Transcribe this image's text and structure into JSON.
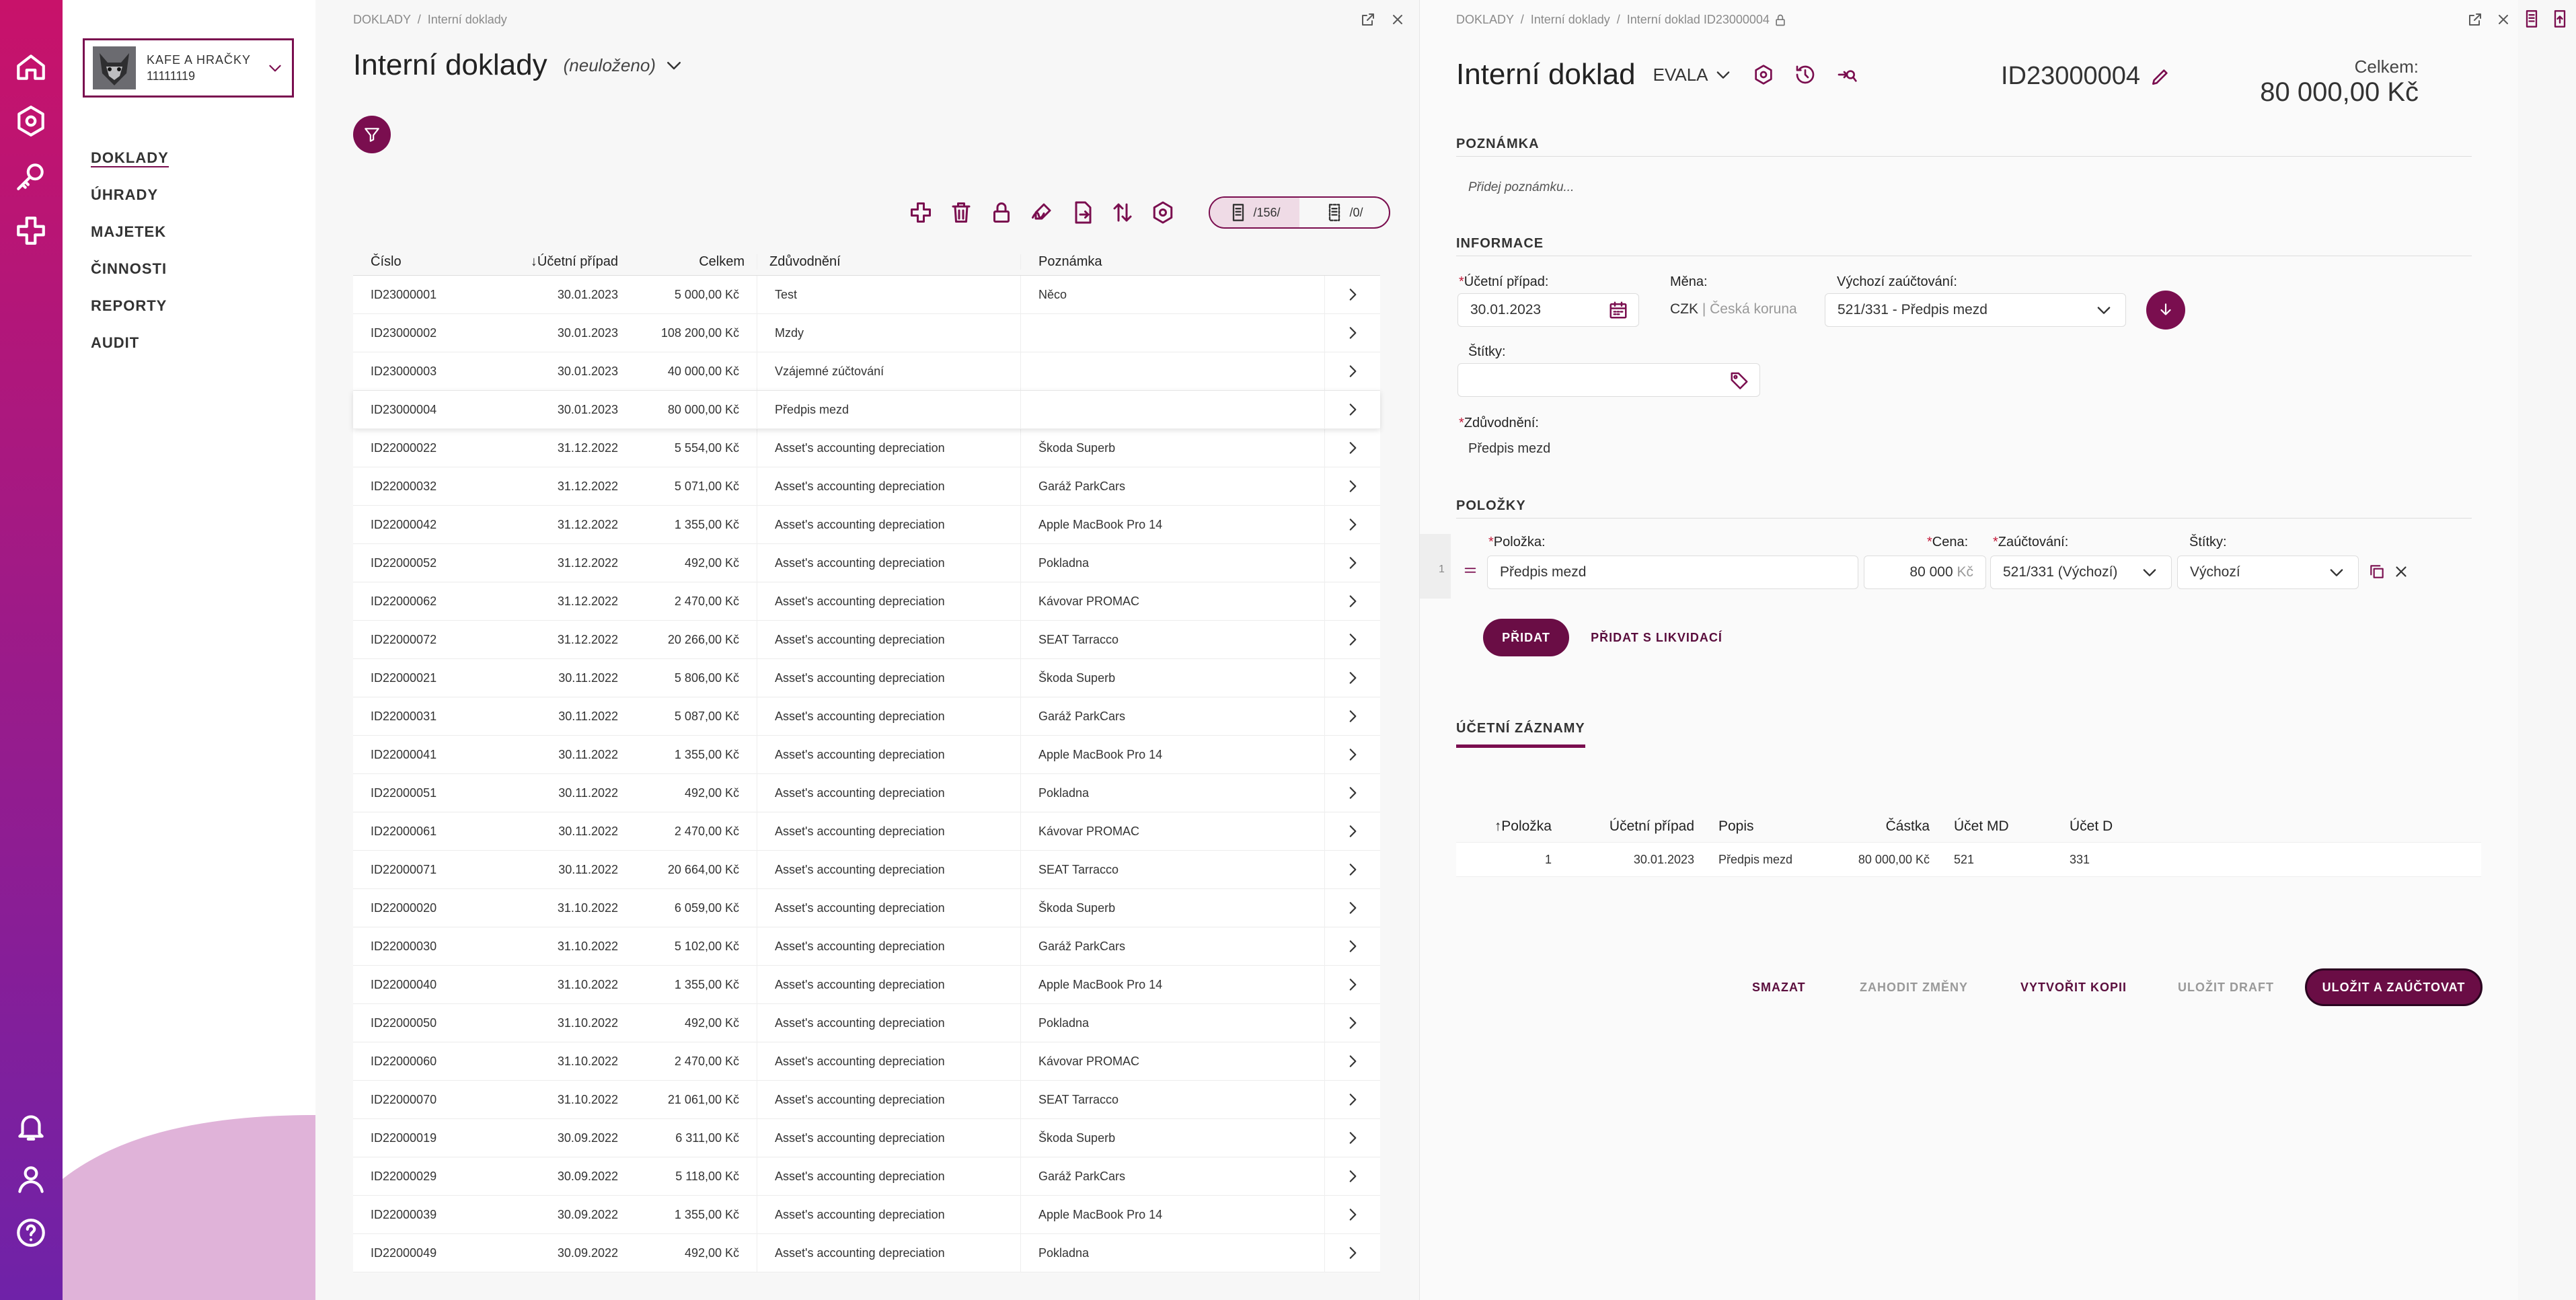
{
  "company": {
    "name": "KAFE A HRAČKY",
    "id": "11111119"
  },
  "nav": [
    "DOKLADY",
    "ÚHRADY",
    "MAJETEK",
    "ČINNOSTI",
    "REPORTY",
    "AUDIT"
  ],
  "list": {
    "breadcrumb": "DOKLADY  /  Interní doklady",
    "title": "Interní doklady",
    "status": "(neuloženo)",
    "toggle": {
      "left": "/156/",
      "right": "/0/"
    },
    "columns": [
      "Číslo",
      "Účetní případ",
      "Celkem",
      "Zdůvodnění",
      "Poznámka"
    ],
    "rows": [
      [
        "ID23000001",
        "30.01.2023",
        "5 000,00 Kč",
        "Test",
        "Něco"
      ],
      [
        "ID23000002",
        "30.01.2023",
        "108 200,00 Kč",
        "Mzdy",
        ""
      ],
      [
        "ID23000003",
        "30.01.2023",
        "40 000,00 Kč",
        "Vzájemné zúčtování",
        ""
      ],
      [
        "ID23000004",
        "30.01.2023",
        "80 000,00 Kč",
        "Předpis mezd",
        ""
      ],
      [
        "ID22000022",
        "31.12.2022",
        "5 554,00 Kč",
        "Asset's accounting depreciation",
        "Škoda Superb"
      ],
      [
        "ID22000032",
        "31.12.2022",
        "5 071,00 Kč",
        "Asset's accounting depreciation",
        "Garáž ParkCars"
      ],
      [
        "ID22000042",
        "31.12.2022",
        "1 355,00 Kč",
        "Asset's accounting depreciation",
        "Apple MacBook Pro 14"
      ],
      [
        "ID22000052",
        "31.12.2022",
        "492,00 Kč",
        "Asset's accounting depreciation",
        "Pokladna"
      ],
      [
        "ID22000062",
        "31.12.2022",
        "2 470,00 Kč",
        "Asset's accounting depreciation",
        "Kávovar PROMAC"
      ],
      [
        "ID22000072",
        "31.12.2022",
        "20 266,00 Kč",
        "Asset's accounting depreciation",
        "SEAT Tarracco"
      ],
      [
        "ID22000021",
        "30.11.2022",
        "5 806,00 Kč",
        "Asset's accounting depreciation",
        "Škoda Superb"
      ],
      [
        "ID22000031",
        "30.11.2022",
        "5 087,00 Kč",
        "Asset's accounting depreciation",
        "Garáž ParkCars"
      ],
      [
        "ID22000041",
        "30.11.2022",
        "1 355,00 Kč",
        "Asset's accounting depreciation",
        "Apple MacBook Pro 14"
      ],
      [
        "ID22000051",
        "30.11.2022",
        "492,00 Kč",
        "Asset's accounting depreciation",
        "Pokladna"
      ],
      [
        "ID22000061",
        "30.11.2022",
        "2 470,00 Kč",
        "Asset's accounting depreciation",
        "Kávovar PROMAC"
      ],
      [
        "ID22000071",
        "30.11.2022",
        "20 664,00 Kč",
        "Asset's accounting depreciation",
        "SEAT Tarracco"
      ],
      [
        "ID22000020",
        "31.10.2022",
        "6 059,00 Kč",
        "Asset's accounting depreciation",
        "Škoda Superb"
      ],
      [
        "ID22000030",
        "31.10.2022",
        "5 102,00 Kč",
        "Asset's accounting depreciation",
        "Garáž ParkCars"
      ],
      [
        "ID22000040",
        "31.10.2022",
        "1 355,00 Kč",
        "Asset's accounting depreciation",
        "Apple MacBook Pro 14"
      ],
      [
        "ID22000050",
        "31.10.2022",
        "492,00 Kč",
        "Asset's accounting depreciation",
        "Pokladna"
      ],
      [
        "ID22000060",
        "31.10.2022",
        "2 470,00 Kč",
        "Asset's accounting depreciation",
        "Kávovar PROMAC"
      ],
      [
        "ID22000070",
        "31.10.2022",
        "21 061,00 Kč",
        "Asset's accounting depreciation",
        "SEAT Tarracco"
      ],
      [
        "ID22000019",
        "30.09.2022",
        "6 311,00 Kč",
        "Asset's accounting depreciation",
        "Škoda Superb"
      ],
      [
        "ID22000029",
        "30.09.2022",
        "5 118,00 Kč",
        "Asset's accounting depreciation",
        "Garáž ParkCars"
      ],
      [
        "ID22000039",
        "30.09.2022",
        "1 355,00 Kč",
        "Asset's accounting depreciation",
        "Apple MacBook Pro 14"
      ],
      [
        "ID22000049",
        "30.09.2022",
        "492,00 Kč",
        "Asset's accounting depreciation",
        "Pokladna"
      ]
    ]
  },
  "detail": {
    "breadcrumb": "DOKLADY  /  Interní doklady  /  Interní doklad ID23000004",
    "title": "Interní doklad",
    "user": "EVALA",
    "doc_id": "ID23000004",
    "total_label": "Celkem:",
    "total_value": "80 000,00 Kč",
    "poznamka": {
      "section": "POZNÁMKA",
      "placeholder": "Přidej poznámku..."
    },
    "informace": {
      "section": "INFORMACE",
      "ucetni_pripad_label": "Účetní případ:",
      "ucetni_pripad": "30.01.2023",
      "mena_label": "Měna:",
      "mena_code": "CZK",
      "mena_name": "Česká koruna",
      "vychozi_label": "Výchozí zaúčtování:",
      "vychozi": "521/331 - Předpis mezd",
      "stitky_label": "Štítky:",
      "zduvodneni_label": "Zdůvodnění:",
      "zduvodneni": "Předpis mezd"
    },
    "polozky": {
      "section": "POLOŽKY",
      "h_polozka": "Položka:",
      "h_cena": "Cena:",
      "h_zauct": "Zaúčtování:",
      "h_stitky": "Štítky:",
      "row_num": "1",
      "polozka": "Předpis mezd",
      "cena": "80 000",
      "cena_unit": "Kč",
      "zauct": "521/331 (Výchozí)",
      "stitky": "Výchozí",
      "btn_add": "PŘIDAT",
      "btn_add_liq": "PŘIDAT S LIKVIDACÍ"
    },
    "ucetni_zaznamy": {
      "tab": "ÚČETNÍ ZÁZNAMY",
      "columns": [
        "Položka",
        "Účetní případ",
        "Popis",
        "Částka",
        "Účet MD",
        "Účet D"
      ],
      "row": [
        "1",
        "30.01.2023",
        "Předpis mezd",
        "80 000,00 Kč",
        "521",
        "331"
      ]
    },
    "footer": {
      "smazat": "SMAZAT",
      "zahodit": "ZAHODIT ZMĚNY",
      "kopie": "VYTVOŘIT KOPII",
      "draft": "ULOŽIT DRAFT",
      "ulozit": "ULOŽIT A ZAÚČTOVAT"
    }
  },
  "colors": {
    "brand": "#7a0e4f",
    "rail_top": "#c8126a",
    "rail_bottom": "#6f22a8",
    "tag_required": "#c41a3a"
  }
}
